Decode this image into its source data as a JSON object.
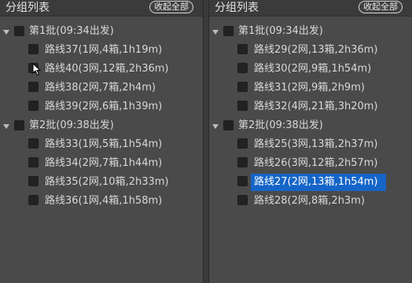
{
  "panels": [
    {
      "title": "分组列表",
      "collapse_label": "收起全部",
      "groups": [
        {
          "label": "第1批(09:34出发)",
          "routes": [
            "路线37(1网,4箱,1h19m)",
            "路线40(3网,12箱,2h36m)",
            "路线38(2网,7箱,2h4m)",
            "路线39(2网,6箱,1h39m)"
          ]
        },
        {
          "label": "第2批(09:38出发)",
          "routes": [
            "路线33(1网,5箱,1h54m)",
            "路线34(2网,7箱,1h44m)",
            "路线35(2网,10箱,2h33m)",
            "路线36(1网,4箱,1h58m)"
          ]
        }
      ]
    },
    {
      "title": "分组列表",
      "collapse_label": "收起全部",
      "groups": [
        {
          "label": "第1批(09:34出发)",
          "routes": [
            "路线29(2网,13箱,2h36m)",
            "路线30(2网,9箱,1h54m)",
            "路线31(2网,9箱,2h9m)",
            "路线32(4网,21箱,3h20m)"
          ]
        },
        {
          "label": "第2批(09:38出发)",
          "routes": [
            "路线25(3网,13箱,2h37m)",
            "路线26(3网,12箱,2h57m)",
            "路线27(2网,13箱,1h54m)",
            "路线28(2网,8箱,2h3m)"
          ]
        }
      ]
    }
  ],
  "selected": {
    "panel": 1,
    "group": 1,
    "route": 2
  },
  "colors": {
    "panel_bg": "#4a4a4a",
    "header_bg": "#3b3b3b",
    "selection": "#1565c8",
    "text": "#d8d8d8"
  },
  "icons": [
    "expand-arrow-icon",
    "checkbox-icon",
    "mouse-pointer-icon"
  ]
}
